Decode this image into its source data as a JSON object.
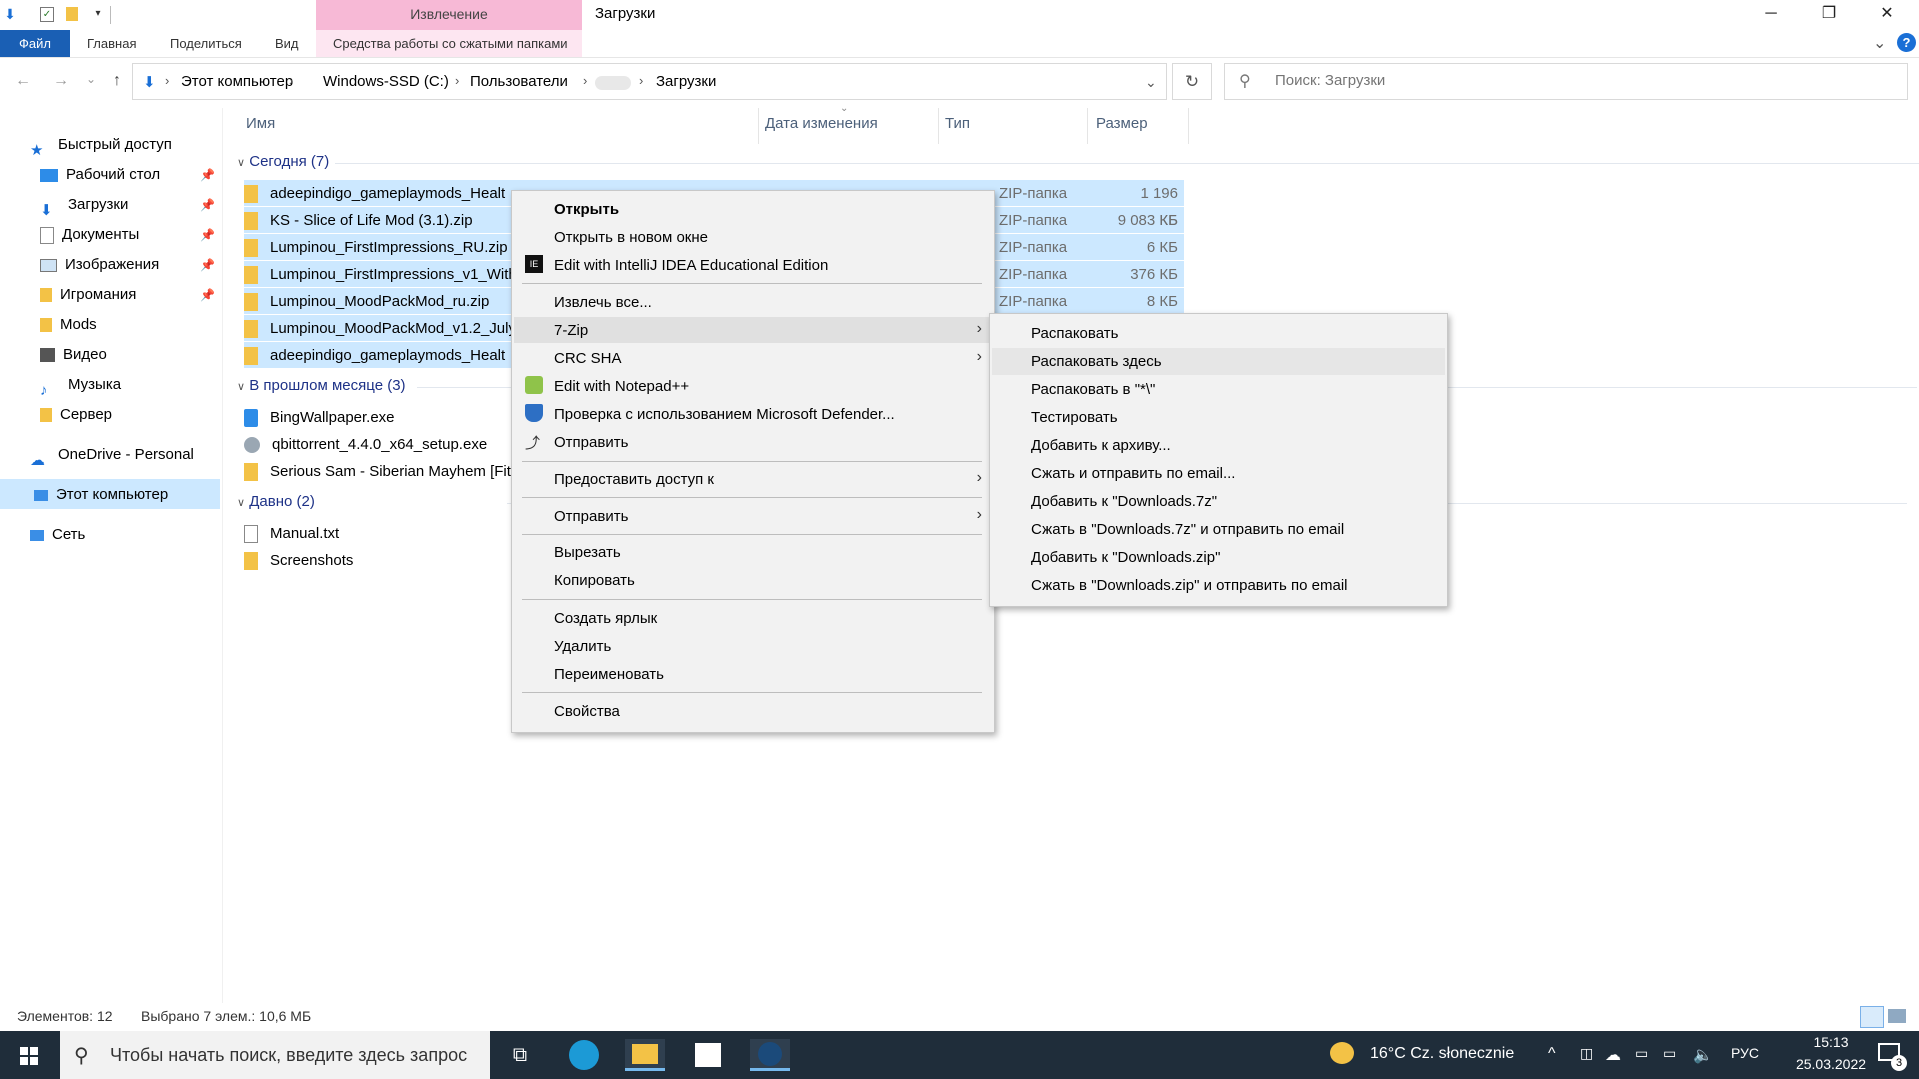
{
  "window": {
    "title": "Загрузки",
    "context_tab_top": "Извлечение",
    "minimize": "─",
    "maximize": "❐",
    "close": "✕",
    "help": "?",
    "collapse": "⌄"
  },
  "ribbon": {
    "tabs": [
      "Файл",
      "Главная",
      "Поделиться",
      "Вид",
      "Средства работы со сжатыми папками"
    ]
  },
  "nav": {
    "back": "←",
    "forward": "→",
    "recent": "⌄",
    "up": "↑",
    "breadcrumbs": [
      "Этот компьютер",
      "Windows-SSD (C:)",
      "Пользователи",
      "Загрузки"
    ],
    "refresh": "↻",
    "search_placeholder": "Поиск: Загрузки"
  },
  "sidebar": {
    "items": [
      {
        "label": "Быстрый доступ",
        "icon": "star-icon"
      },
      {
        "label": "Рабочий стол",
        "icon": "desktop-icon",
        "pinned": true
      },
      {
        "label": "Загрузки",
        "icon": "download-icon",
        "pinned": true
      },
      {
        "label": "Документы",
        "icon": "document-icon",
        "pinned": true
      },
      {
        "label": "Изображения",
        "icon": "pictures-icon",
        "pinned": true
      },
      {
        "label": "Игромания",
        "icon": "folder-icon",
        "pinned": true
      },
      {
        "label": "Mods",
        "icon": "folder-icon"
      },
      {
        "label": "Видео",
        "icon": "video-icon"
      },
      {
        "label": "Музыка",
        "icon": "music-icon"
      },
      {
        "label": "Сервер",
        "icon": "folder-icon"
      },
      {
        "label": "OneDrive - Personal",
        "icon": "cloud-icon"
      },
      {
        "label": "Этот компьютер",
        "icon": "computer-icon"
      },
      {
        "label": "Сеть",
        "icon": "network-icon"
      }
    ]
  },
  "columns": {
    "name": "Имя",
    "date": "Дата изменения",
    "type": "Тип",
    "size": "Размер"
  },
  "groups": {
    "today": "Сегодня (7)",
    "last_month": "В прошлом месяце (3)",
    "long_ago": "Давно (2)"
  },
  "files_today": [
    {
      "name": "adeepindigo_gameplaymods_Healt",
      "type": "ZIP-папка",
      "size": "1 196 КБ"
    },
    {
      "name": "KS - Slice of Life Mod (3.1).zip",
      "type": "ZIP-папка",
      "size": "9 083 КБ"
    },
    {
      "name": "Lumpinou_FirstImpressions_RU.zip",
      "type": "ZIP-папка",
      "size": "6 КБ"
    },
    {
      "name": "Lumpinou_FirstImpressions_v1_WithT",
      "type": "ZIP-папка",
      "size": "376 КБ"
    },
    {
      "name": "Lumpinou_MoodPackMod_ru.zip",
      "type": "ZIP-папка",
      "size": "8 КБ"
    },
    {
      "name": "Lumpinou_MoodPackMod_v1.2_July2",
      "type": "",
      "size": ""
    },
    {
      "name": "adeepindigo_gameplaymods_Healt",
      "type": "",
      "size": ""
    }
  ],
  "files_last_month": [
    {
      "name": "BingWallpaper.exe"
    },
    {
      "name": "qbittorrent_4.4.0_x64_setup.exe"
    },
    {
      "name": "Serious Sam - Siberian Mayhem [FitG"
    }
  ],
  "files_long_ago": [
    {
      "name": "Manual.txt"
    },
    {
      "name": "Screenshots"
    }
  ],
  "context_menu": {
    "open": "Открыть",
    "open_new_window": "Открыть в новом окне",
    "edit_intellij": "Edit with IntelliJ IDEA Educational Edition",
    "extract_all": "Извлечь все...",
    "seven_zip": "7-Zip",
    "crc_sha": "CRC SHA",
    "edit_notepad": "Edit with Notepad++",
    "defender": "Проверка с использованием Microsoft Defender...",
    "share": "Отправить",
    "give_access": "Предоставить доступ к",
    "send_to": "Отправить",
    "cut": "Вырезать",
    "copy": "Копировать",
    "create_shortcut": "Создать ярлык",
    "delete": "Удалить",
    "rename": "Переименовать",
    "properties": "Свойства"
  },
  "submenu_7zip": [
    "Распаковать",
    "Распаковать здесь",
    "Распаковать в \"*\\\"",
    "Тестировать",
    "Добавить к архиву...",
    "Сжать и отправить по email...",
    "Добавить к \"Downloads.7z\"",
    "Сжать в \"Downloads.7z\" и отправить по email",
    "Добавить к \"Downloads.zip\"",
    "Сжать в \"Downloads.zip\" и отправить по email"
  ],
  "status": {
    "items": "Элементов: 12",
    "selected": "Выбрано 7 элем.: 10,6 МБ"
  },
  "taskbar": {
    "search_text": "Чтобы начать поиск, введите здесь запрос",
    "weather": "16°C  Cz. słonecznie",
    "lang": "РУС",
    "time": "15:13",
    "date": "25.03.2022",
    "notifications": "3"
  },
  "colors": {
    "selection": "#cce8ff",
    "file_tab": "#1a5fb4",
    "context_tab": "#f7b9d6",
    "taskbar": "#1f2d3a"
  }
}
